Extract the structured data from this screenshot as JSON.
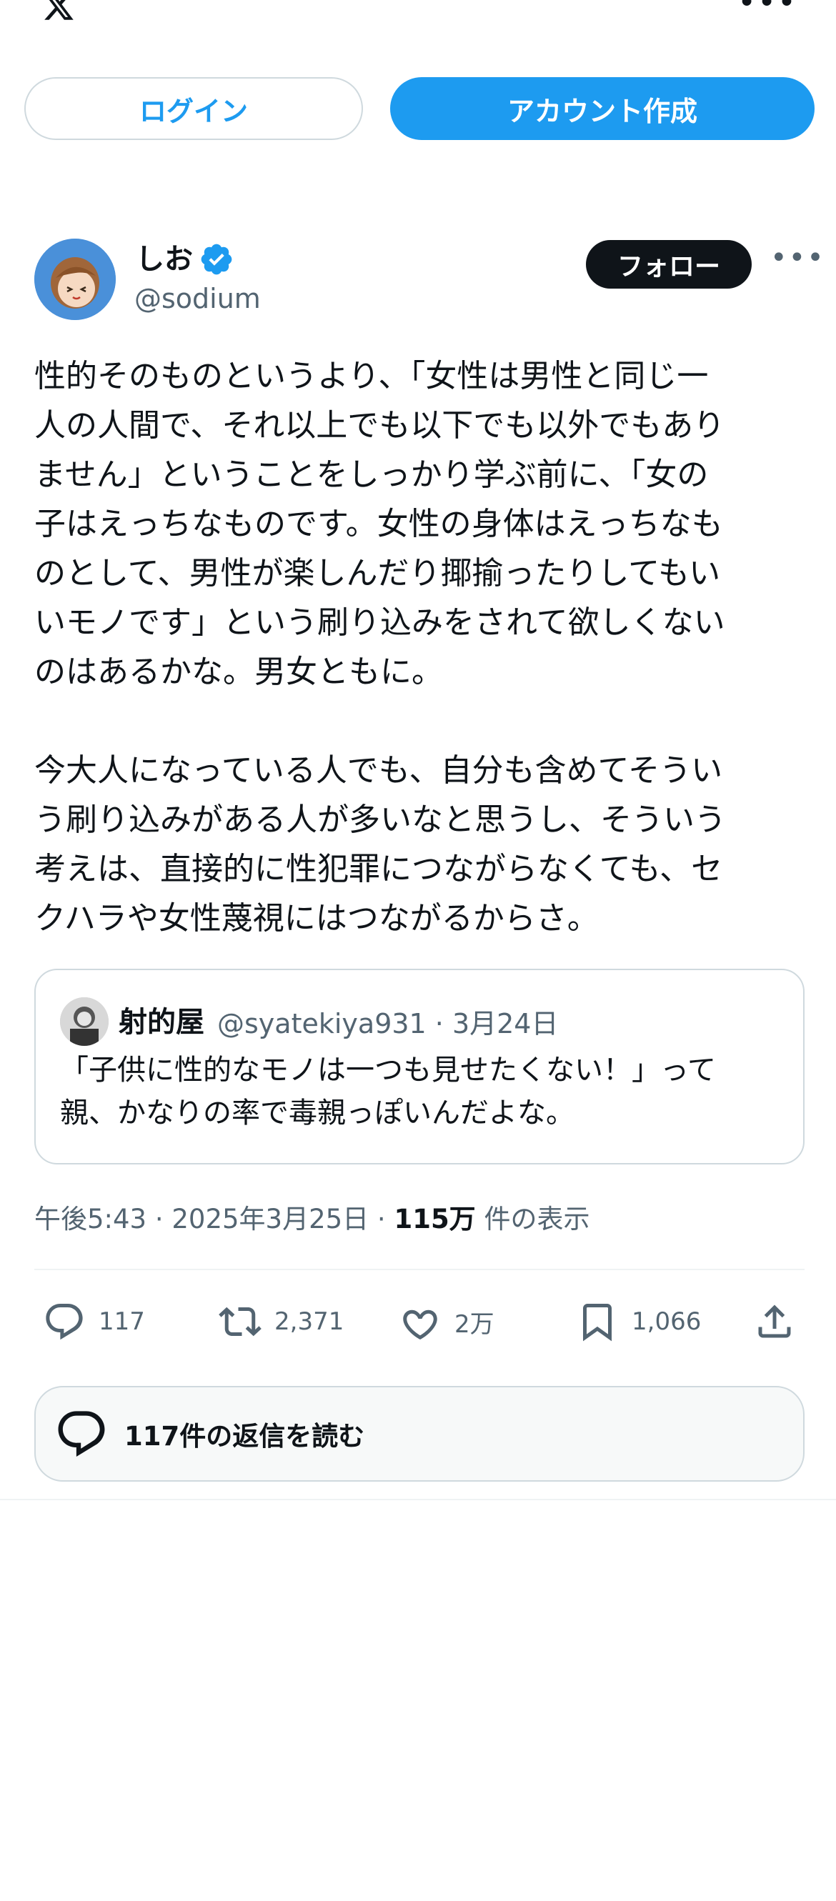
{
  "colors": {
    "accent": "#1d9bf0",
    "text": "#0f1419",
    "muted": "#536471",
    "border": "#cfd9de"
  },
  "header": {
    "logo_icon": "x-logo-icon",
    "more_icon": "more-horizontal-icon"
  },
  "auth": {
    "login_label": "ログイン",
    "signup_label": "アカウント作成"
  },
  "author": {
    "name": "しお",
    "handle": "@sodium",
    "verified": true,
    "follow_label": "フォロー"
  },
  "post": {
    "text": "性的そのものというより、「女性は男性と同じ一\n人の人間で、それ以上でも以下でも以外でもあり\nません」ということをしっかり学ぶ前に、「女の\n子はえっちなものです。女性の身体はえっちなも\nのとして、男性が楽しんだり揶揄ったりしてもい\nいモノです」という刷り込みをされて欲しくない\nのはあるかな。男女ともに。\n\n今大人になっている人でも、自分も含めてそうい\nう刷り込みがある人が多いなと思うし、そういう\n考えは、直接的に性犯罪につながらなくても、セ\nクハラや女性蔑視にはつながるからさ。"
  },
  "quote": {
    "name": "射的屋",
    "handle_date": "@syatekiya931 · 3月24日",
    "text": "「子供に性的なモノは一つも見せたくない！」って\n親、かなりの率で毒親っぽいんだよな。"
  },
  "meta": {
    "time_date": "午後5:43 · 2025年3月25日 · ",
    "views_count": "115万",
    "views_label": " 件の表示"
  },
  "actions": {
    "replies": "117",
    "reposts": "2,371",
    "likes": "2万",
    "bookmarks": "1,066"
  },
  "read_replies_label": "117件の返信を読む"
}
